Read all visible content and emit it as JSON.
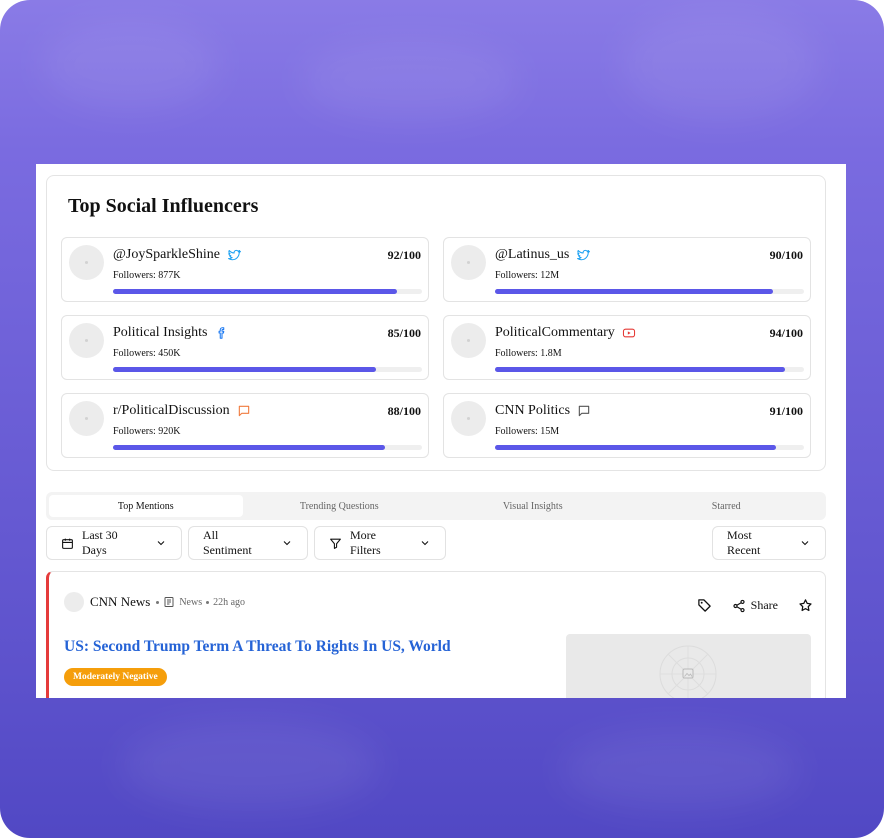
{
  "panel": {
    "title": "Top Social Influencers",
    "followers_label": "Followers:",
    "influencers": [
      {
        "name": "@JoySparkleShine",
        "platform": "twitter-icon",
        "score": "92/100",
        "followers": "877K",
        "score_value": 92,
        "platform_color": "#1da1f2"
      },
      {
        "name": "@Latinus_us",
        "platform": "twitter-icon",
        "score": "90/100",
        "followers": "12M",
        "score_value": 90,
        "platform_color": "#1da1f2"
      },
      {
        "name": "Political Insights",
        "platform": "facebook-icon",
        "score": "85/100",
        "followers": "450K",
        "score_value": 85,
        "platform_color": "#1877f2"
      },
      {
        "name": "PoliticalCommentary",
        "platform": "youtube-icon",
        "score": "94/100",
        "followers": "1.8M",
        "score_value": 94,
        "platform_color": "#e53935"
      },
      {
        "name": "r/PoliticalDiscussion",
        "platform": "reddit-chat-icon",
        "score": "88/100",
        "followers": "920K",
        "score_value": 88,
        "platform_color": "#f07b3f"
      },
      {
        "name": "CNN Politics",
        "platform": "chat-bubble-icon",
        "score": "91/100",
        "followers": "15M",
        "score_value": 91,
        "platform_color": "#555555"
      }
    ]
  },
  "tabs": [
    {
      "label": "Top Mentions",
      "active": true
    },
    {
      "label": "Trending Questions",
      "active": false
    },
    {
      "label": "Visual Insights",
      "active": false
    },
    {
      "label": "Starred",
      "active": false
    }
  ],
  "filters": {
    "date_range": "Last 30 Days",
    "sentiment": "All Sentiment",
    "more": "More Filters",
    "sort": "Most Recent"
  },
  "article": {
    "source": "CNN News",
    "type": "News",
    "time": "22h ago",
    "share_label": "Share",
    "headline": "US: Second Trump Term A Threat To Rights In US, World",
    "sentiment": "Moderately Negative",
    "accent_color": "#e53b3b",
    "sentiment_color": "#f59e0b",
    "headline_color": "#2563d6"
  },
  "colors": {
    "progress": "#5b57e8",
    "background_top": "#8a7be6",
    "background_bottom": "#5148c4"
  }
}
